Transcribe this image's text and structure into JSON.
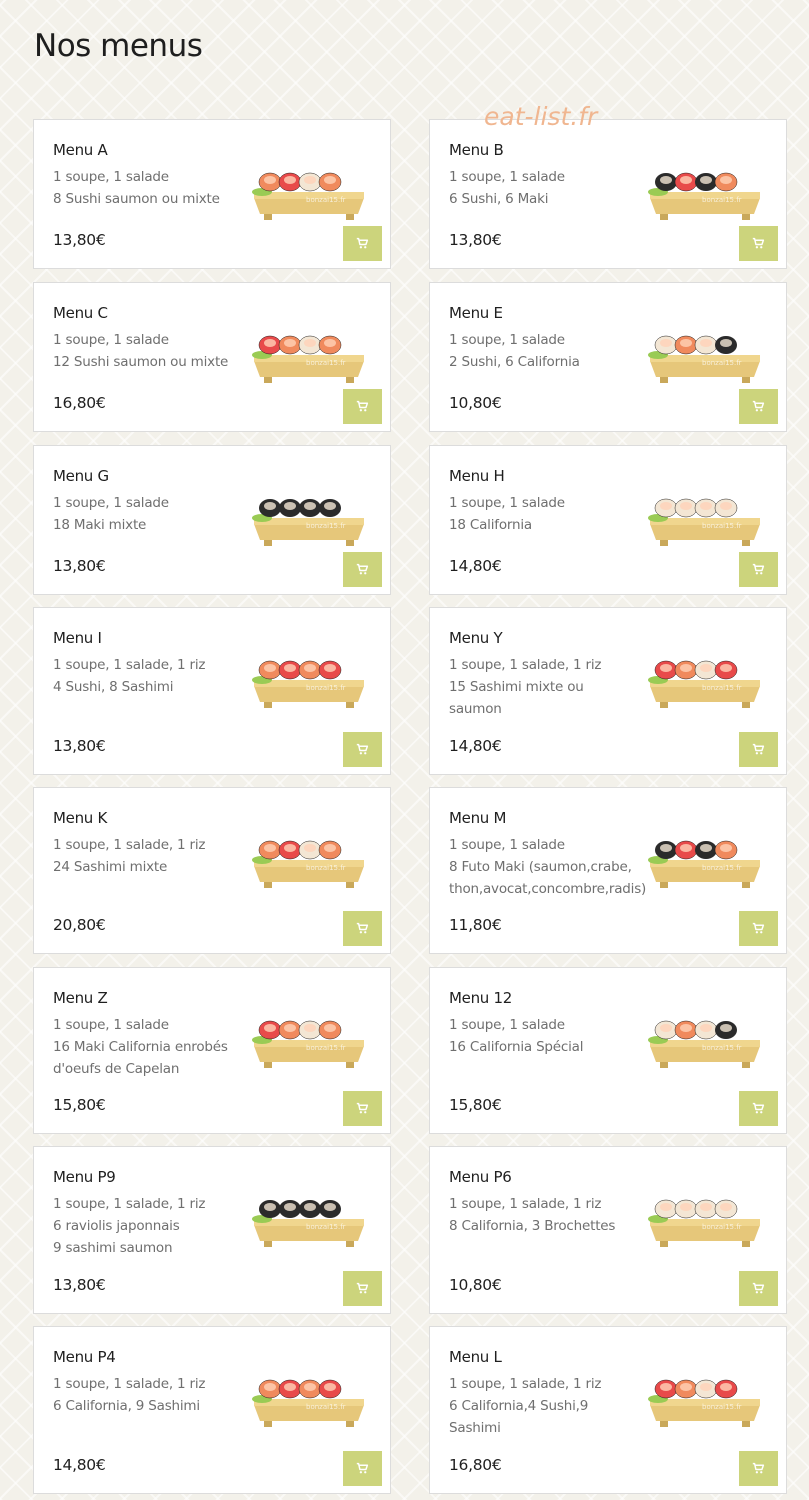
{
  "page": {
    "title": "Nos menus",
    "watermark": "eat-list.fr"
  },
  "colors": {
    "cart_button": "#ccd47c",
    "card_border": "#dcdcdc",
    "watermark": "#f0b690"
  },
  "cart_icon": "shopping-cart-icon",
  "menus": [
    {
      "name": "Menu A",
      "lines": [
        "1 soupe, 1 salade",
        "8 Sushi saumon ou mixte"
      ],
      "price": "13,80€"
    },
    {
      "name": "Menu B",
      "lines": [
        "1 soupe, 1 salade",
        "6 Sushi, 6 Maki"
      ],
      "price": "13,80€"
    },
    {
      "name": "Menu C",
      "lines": [
        "1 soupe, 1 salade",
        "12 Sushi saumon ou mixte"
      ],
      "price": "16,80€"
    },
    {
      "name": "Menu E",
      "lines": [
        "1 soupe, 1 salade",
        "2 Sushi, 6 California"
      ],
      "price": "10,80€"
    },
    {
      "name": "Menu G",
      "lines": [
        "1 soupe, 1 salade",
        "18 Maki mixte"
      ],
      "price": "13,80€"
    },
    {
      "name": "Menu H",
      "lines": [
        "1 soupe, 1 salade",
        "18 California"
      ],
      "price": "14,80€"
    },
    {
      "name": "Menu I",
      "lines": [
        "1 soupe, 1 salade, 1 riz",
        "4 Sushi, 8 Sashimi"
      ],
      "price": "13,80€"
    },
    {
      "name": "Menu Y",
      "lines": [
        "1 soupe, 1 salade, 1 riz",
        "15 Sashimi mixte ou",
        "saumon"
      ],
      "price": "14,80€"
    },
    {
      "name": "Menu K",
      "lines": [
        "1 soupe, 1 salade, 1 riz",
        "24 Sashimi mixte"
      ],
      "price": "20,80€"
    },
    {
      "name": "Menu M",
      "lines": [
        "1 soupe, 1 salade",
        "8 Futo Maki (saumon,crabe,",
        "thon,avocat,concombre,radis)"
      ],
      "price": "11,80€"
    },
    {
      "name": "Menu Z",
      "lines": [
        "1 soupe, 1 salade",
        "16 Maki California enrobés",
        "d'oeufs de Capelan"
      ],
      "price": "15,80€"
    },
    {
      "name": "Menu 12",
      "lines": [
        "1 soupe, 1 salade",
        "16 California Spécial"
      ],
      "price": "15,80€"
    },
    {
      "name": "Menu P9",
      "lines": [
        "1 soupe, 1 salade, 1 riz",
        "6 raviolis japonnais",
        "9 sashimi saumon"
      ],
      "price": "13,80€"
    },
    {
      "name": "Menu P6",
      "lines": [
        "1 soupe, 1 salade, 1 riz",
        "8 California, 3 Brochettes"
      ],
      "price": "10,80€"
    },
    {
      "name": "Menu P4",
      "lines": [
        "1 soupe, 1 salade, 1 riz",
        "6 California, 9 Sashimi"
      ],
      "price": "14,80€"
    },
    {
      "name": "Menu L",
      "lines": [
        "1 soupe, 1 salade, 1 riz",
        "6 California,4 Sushi,9",
        "Sashimi"
      ],
      "price": "16,80€"
    }
  ]
}
